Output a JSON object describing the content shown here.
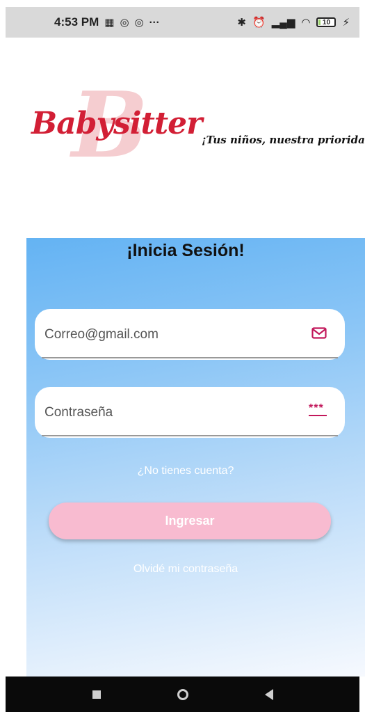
{
  "status_bar": {
    "time": "4:53 PM",
    "battery_level": "10",
    "left_icons": [
      "qr-icon",
      "sync-icon",
      "sync-icon",
      "more-icon"
    ],
    "right_icons": [
      "bluetooth-icon",
      "alarm-icon",
      "signal-icon",
      "wifi-icon",
      "battery-icon",
      "charging-icon"
    ]
  },
  "brand": {
    "logo_text": "Babysitter",
    "logo_letter": "B",
    "tagline": "¡Tus niños, nuestra prioridad!",
    "accent_color": "#d21f35"
  },
  "login": {
    "title": "¡Inicia Sesión!",
    "email_placeholder": "Correo@gmail.com",
    "password_placeholder": "Contraseña",
    "password_icon_glyph": "***",
    "no_account_link": "¿No tienes cuenta?",
    "submit_label": "Ingresar",
    "forgot_link": "Olvidé mi contraseña",
    "button_color": "#f8bbd0",
    "icon_color": "#c2185b"
  },
  "nav_bar": {
    "items": [
      "recents-button",
      "home-button",
      "back-button"
    ]
  }
}
